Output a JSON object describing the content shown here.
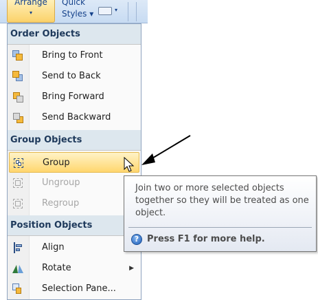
{
  "ribbon": {
    "arrange_label": "Arrange",
    "arrange_caret": "▾",
    "quick_styles_line1": "Quick",
    "quick_styles_line2": "Styles ▾",
    "shape_caret": "▾"
  },
  "menu": {
    "order_header": "Order Objects",
    "bring_to_front": "Bring to Front",
    "send_to_back": "Send to Back",
    "bring_forward": "Bring Forward",
    "send_backward": "Send Backward",
    "group_header": "Group Objects",
    "group": "Group",
    "ungroup": "Ungroup",
    "regroup": "Regroup",
    "position_header": "Position Objects",
    "align": "Align",
    "rotate": "Rotate",
    "rotate_submenu_arrow": "▶",
    "selection_pane": "Selection Pane..."
  },
  "tooltip": {
    "description": "Join two or more selected objects together so they will be treated as one object.",
    "help_icon": "?",
    "help_text": "Press F1 for more help."
  },
  "colors": {
    "highlight": "#ffd66e",
    "header_bg": "#dde7ee",
    "header_text": "#1e395b",
    "disabled_text": "#a6a6a6"
  },
  "icons": {
    "bring_to_front": "bring-to-front-icon",
    "send_to_back": "send-to-back-icon",
    "bring_forward": "bring-forward-icon",
    "send_backward": "send-backward-icon",
    "group": "group-icon",
    "ungroup": "ungroup-icon",
    "regroup": "regroup-icon",
    "align": "align-icon",
    "rotate": "rotate-icon",
    "selection_pane": "selection-pane-icon",
    "help": "help-icon"
  }
}
